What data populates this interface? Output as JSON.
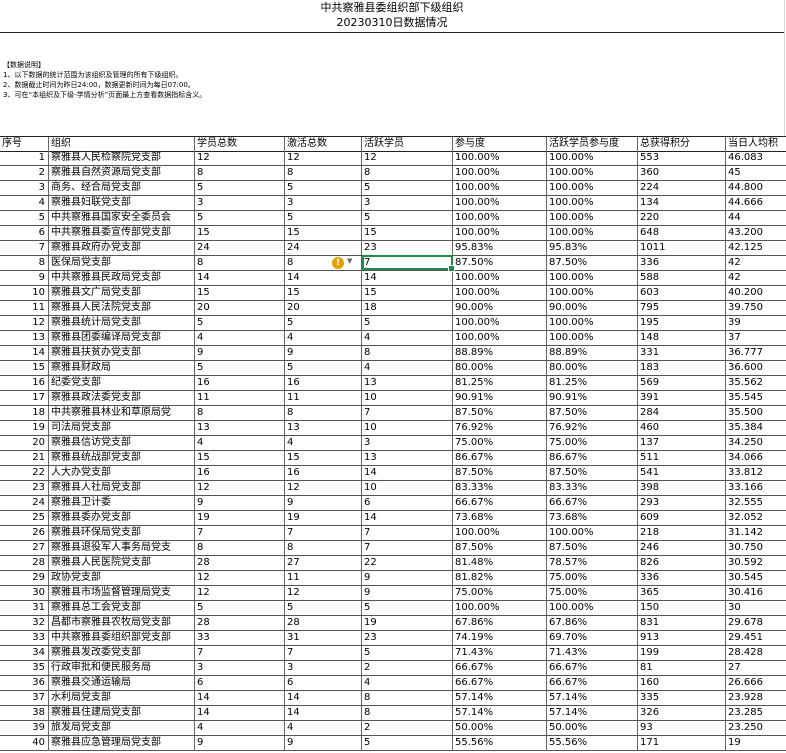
{
  "title": {
    "line1": "中共察雅县委组织部下级组织",
    "line2": "20230310日数据情况"
  },
  "notes": {
    "heading": "【数据说明】",
    "items": [
      "1、以下数据的统计范围为该组织及管理的所有下级组织。",
      "2、数据截止时间为昨日24:00，数据更新时间为每日07:00。",
      "3、可在“本组织及下级-学情分析”页面最上方查看数据指标含义。"
    ]
  },
  "table": {
    "headers": [
      "序号",
      "组织",
      "学员总数",
      "激活总数",
      "活跃学员",
      "参与度",
      "活跃学员参与度",
      "总获得积分",
      "当日人均积"
    ],
    "rows": [
      [
        "1",
        "察雅县人民检察院党支部",
        "12",
        "12",
        "12",
        "100.00%",
        "100.00%",
        "553",
        "46.083"
      ],
      [
        "2",
        "察雅县自然资源局党支部",
        "8",
        "8",
        "8",
        "100.00%",
        "100.00%",
        "360",
        "45"
      ],
      [
        "3",
        "商务、经合局党支部",
        "5",
        "5",
        "5",
        "100.00%",
        "100.00%",
        "224",
        "44.800"
      ],
      [
        "4",
        "察雅县妇联党支部",
        "3",
        "3",
        "3",
        "100.00%",
        "100.00%",
        "134",
        "44.666"
      ],
      [
        "5",
        "中共察雅县国家安全委员会",
        "5",
        "5",
        "5",
        "100.00%",
        "100.00%",
        "220",
        "44"
      ],
      [
        "6",
        "中共察雅县委宣传部党支部",
        "15",
        "15",
        "15",
        "100.00%",
        "100.00%",
        "648",
        "43.200"
      ],
      [
        "7",
        "察雅县政府办党支部",
        "24",
        "24",
        "23",
        "95.83%",
        "95.83%",
        "1011",
        "42.125"
      ],
      [
        "8",
        "医保局党支部",
        "8",
        "8",
        "7",
        "87.50%",
        "87.50%",
        "336",
        "42"
      ],
      [
        "9",
        "中共察雅县民政局党支部",
        "14",
        "14",
        "14",
        "100.00%",
        "100.00%",
        "588",
        "42"
      ],
      [
        "10",
        "察雅县文广局党支部",
        "15",
        "15",
        "15",
        "100.00%",
        "100.00%",
        "603",
        "40.200"
      ],
      [
        "11",
        "察雅县人民法院党支部",
        "20",
        "20",
        "18",
        "90.00%",
        "90.00%",
        "795",
        "39.750"
      ],
      [
        "12",
        "察雅县统计局党支部",
        "5",
        "5",
        "5",
        "100.00%",
        "100.00%",
        "195",
        "39"
      ],
      [
        "13",
        "察雅县团委编译局党支部",
        "4",
        "4",
        "4",
        "100.00%",
        "100.00%",
        "148",
        "37"
      ],
      [
        "14",
        "察雅县扶贫办党支部",
        "9",
        "9",
        "8",
        "88.89%",
        "88.89%",
        "331",
        "36.777"
      ],
      [
        "15",
        "察雅县财政局",
        "5",
        "5",
        "4",
        "80.00%",
        "80.00%",
        "183",
        "36.600"
      ],
      [
        "16",
        "纪委党支部",
        "16",
        "16",
        "13",
        "81.25%",
        "81.25%",
        "569",
        "35.562"
      ],
      [
        "17",
        "察雅县政法委党支部",
        "11",
        "11",
        "10",
        "90.91%",
        "90.91%",
        "391",
        "35.545"
      ],
      [
        "18",
        "中共察雅县林业和草原局党",
        "8",
        "8",
        "7",
        "87.50%",
        "87.50%",
        "284",
        "35.500"
      ],
      [
        "19",
        "司法局党支部",
        "13",
        "13",
        "10",
        "76.92%",
        "76.92%",
        "460",
        "35.384"
      ],
      [
        "20",
        "察雅县信访党支部",
        "4",
        "4",
        "3",
        "75.00%",
        "75.00%",
        "137",
        "34.250"
      ],
      [
        "21",
        "察雅县统战部党支部",
        "15",
        "15",
        "13",
        "86.67%",
        "86.67%",
        "511",
        "34.066"
      ],
      [
        "22",
        "人大办党支部",
        "16",
        "16",
        "14",
        "87.50%",
        "87.50%",
        "541",
        "33.812"
      ],
      [
        "23",
        "察雅县人社局党支部",
        "12",
        "12",
        "10",
        "83.33%",
        "83.33%",
        "398",
        "33.166"
      ],
      [
        "24",
        "察雅县卫计委",
        "9",
        "9",
        "6",
        "66.67%",
        "66.67%",
        "293",
        "32.555"
      ],
      [
        "25",
        "察雅县委办党支部",
        "19",
        "19",
        "14",
        "73.68%",
        "73.68%",
        "609",
        "32.052"
      ],
      [
        "26",
        "察雅县环保局党支部",
        "7",
        "7",
        "7",
        "100.00%",
        "100.00%",
        "218",
        "31.142"
      ],
      [
        "27",
        "察雅县退役军人事务局党支",
        "8",
        "8",
        "7",
        "87.50%",
        "87.50%",
        "246",
        "30.750"
      ],
      [
        "28",
        "察雅县人民医院党支部",
        "28",
        "27",
        "22",
        "81.48%",
        "78.57%",
        "826",
        "30.592"
      ],
      [
        "29",
        "政协党支部",
        "12",
        "11",
        "9",
        "81.82%",
        "75.00%",
        "336",
        "30.545"
      ],
      [
        "30",
        "察雅县市场监督管理局党支",
        "12",
        "12",
        "9",
        "75.00%",
        "75.00%",
        "365",
        "30.416"
      ],
      [
        "31",
        "察雅县总工会党支部",
        "5",
        "5",
        "5",
        "100.00%",
        "100.00%",
        "150",
        "30"
      ],
      [
        "32",
        "昌都市察雅县农牧局党支部",
        "28",
        "28",
        "19",
        "67.86%",
        "67.86%",
        "831",
        "29.678"
      ],
      [
        "33",
        "中共察雅县委组织部党支部",
        "33",
        "31",
        "23",
        "74.19%",
        "69.70%",
        "913",
        "29.451"
      ],
      [
        "34",
        "察雅县发改委党支部",
        "7",
        "7",
        "5",
        "71.43%",
        "71.43%",
        "199",
        "28.428"
      ],
      [
        "35",
        "行政审批和便民服务局",
        "3",
        "3",
        "2",
        "66.67%",
        "66.67%",
        "81",
        "27"
      ],
      [
        "36",
        "察雅县交通运输局",
        "6",
        "6",
        "4",
        "66.67%",
        "66.67%",
        "160",
        "26.666"
      ],
      [
        "37",
        "水利局党支部",
        "14",
        "14",
        "8",
        "57.14%",
        "57.14%",
        "335",
        "23.928"
      ],
      [
        "38",
        "察雅县住建局党支部",
        "14",
        "14",
        "8",
        "57.14%",
        "57.14%",
        "326",
        "23.285"
      ],
      [
        "39",
        "旅发局党支部",
        "4",
        "4",
        "2",
        "50.00%",
        "50.00%",
        "93",
        "23.250"
      ],
      [
        "40",
        "察雅县应急管理局党支部",
        "9",
        "9",
        "5",
        "55.56%",
        "55.56%",
        "171",
        "19"
      ]
    ]
  }
}
